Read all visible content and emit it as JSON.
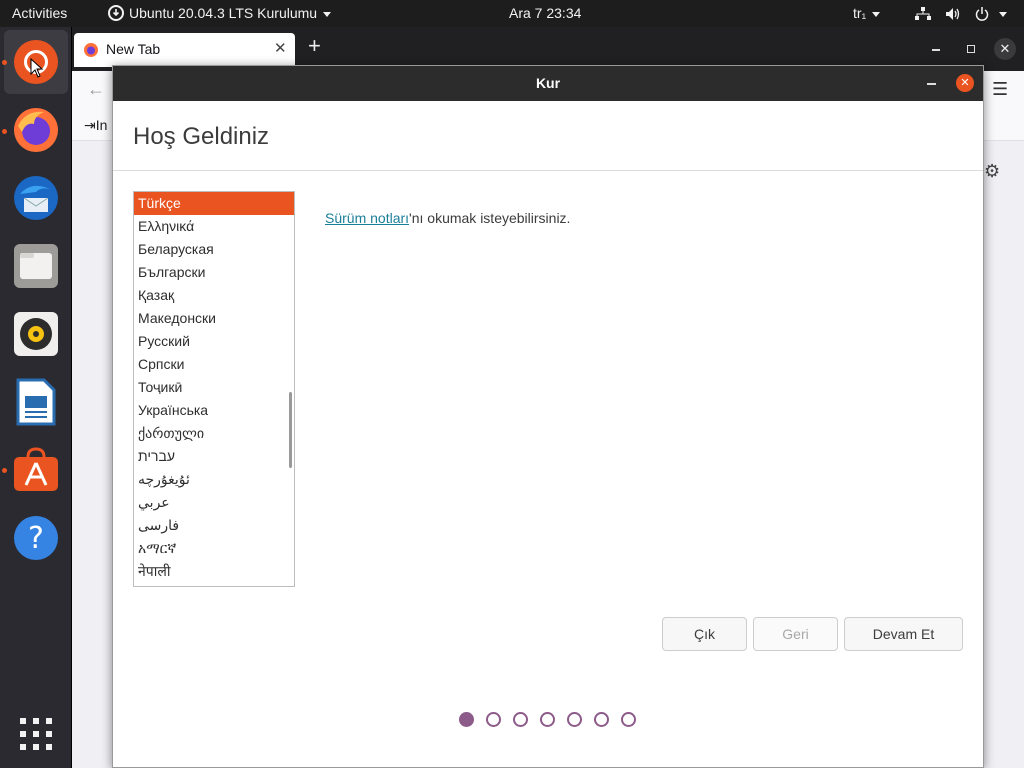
{
  "topbar": {
    "activities": "Activities",
    "app_menu": "Ubuntu 20.04.3 LTS Kurulumu",
    "clock": "Ara 7  23:34",
    "input_source": "tr₁"
  },
  "dock": {
    "apps": [
      {
        "name": "ubuntu-installer",
        "active": true
      },
      {
        "name": "firefox",
        "active": true
      },
      {
        "name": "thunderbird",
        "active": false
      },
      {
        "name": "files",
        "active": false
      },
      {
        "name": "rhythmbox",
        "active": false
      },
      {
        "name": "libreoffice-writer",
        "active": false
      },
      {
        "name": "ubuntu-software",
        "active": true
      },
      {
        "name": "help",
        "active": false
      }
    ],
    "show_apps": "show-applications"
  },
  "browser": {
    "tab_title": "New Tab",
    "bookmark_partial": "In"
  },
  "installer": {
    "window_title": "Kur",
    "heading": "Hoş Geldiniz",
    "languages": [
      "Türkçe",
      "Ελληνικά",
      "Беларуская",
      "Български",
      "Қазақ",
      "Македонски",
      "Русский",
      "Српски",
      "Тоҷикӣ",
      "Українська",
      "ქართული",
      "עברית",
      "ئۇيغۇرچە",
      "عربي",
      "فارسی",
      "አማርኛ",
      "नेपाली"
    ],
    "selected_language": "Türkçe",
    "release_notes_link": "Sürüm notları",
    "release_notes_rest": "'nı okumak isteyebilirsiniz.",
    "buttons": {
      "quit": "Çık",
      "back": "Geri",
      "continue": "Devam Et"
    },
    "progress": {
      "current": 1,
      "total": 7
    },
    "accent": "#e95420"
  }
}
